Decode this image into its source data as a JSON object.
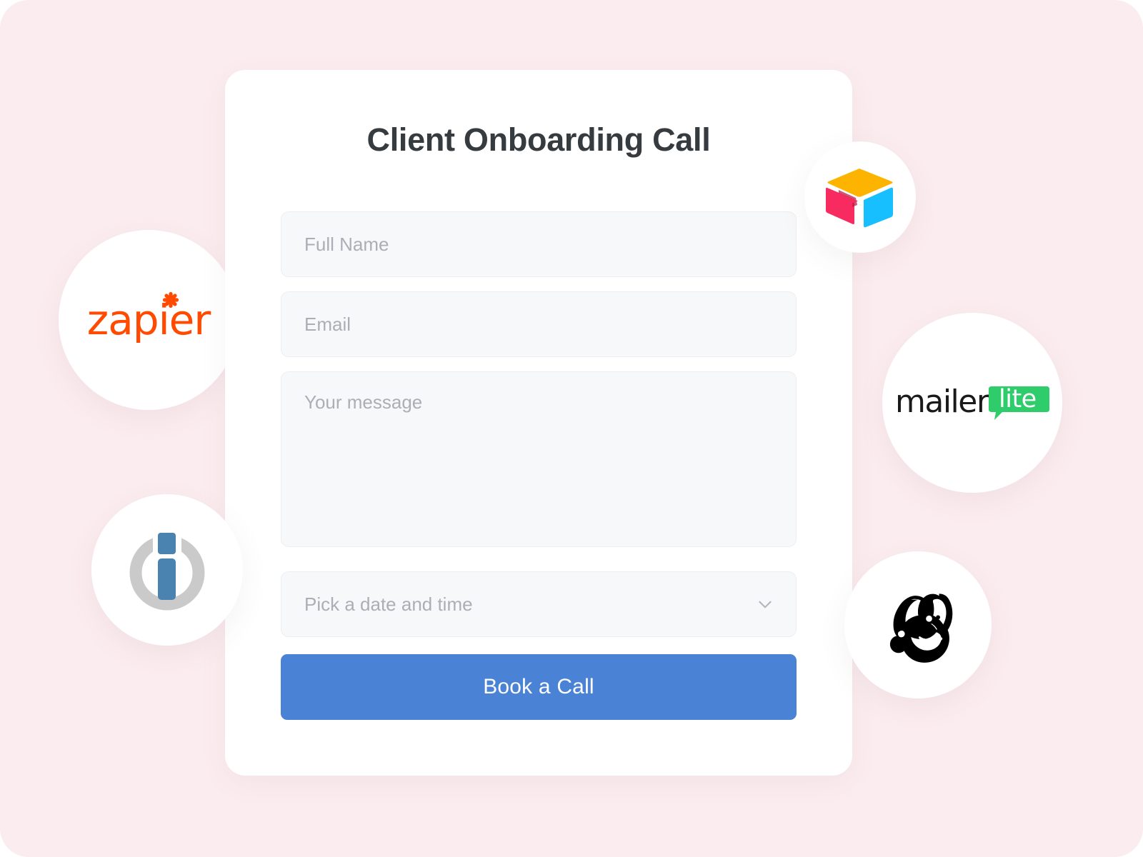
{
  "page": {
    "background_color": "#FBECEF",
    "card_background": "#FFFFFF"
  },
  "form": {
    "title": "Client Onboarding Call",
    "fields": [
      {
        "name": "full-name",
        "placeholder": "Full Name",
        "value": ""
      },
      {
        "name": "email",
        "placeholder": "Email",
        "value": ""
      },
      {
        "name": "message",
        "placeholder": "Your message",
        "value": ""
      },
      {
        "name": "date-time",
        "placeholder": "Pick a date and time",
        "value": ""
      }
    ],
    "submit_label": "Book a Call",
    "submit_color": "#4A82D6",
    "input_background": "#F7F8FA",
    "input_border": "#ECEEF1",
    "placeholder_color": "#AAAFB6",
    "title_color": "#363B3F",
    "dropdown_icon": "chevron-down-icon"
  },
  "badges": [
    {
      "name": "zapier",
      "label": "zapier",
      "icon": "zapier-logo",
      "color": "#FF4A00"
    },
    {
      "name": "activecampaign",
      "label": "ActiveCampaign",
      "icon": "activecampaign-logo",
      "ring_color": "#CACACA",
      "bar_color": "#4A82B0"
    },
    {
      "name": "airtable",
      "label": "Airtable",
      "icon": "airtable-logo",
      "colors": {
        "top": "#FCB400",
        "left": "#F82B60",
        "right": "#18BFFF",
        "left_shadow": "#BA1E48"
      }
    },
    {
      "name": "mailerlite",
      "label": "mailer",
      "badge_label": "lite",
      "icon": "mailerlite-logo",
      "badge_color": "#2ECC6B",
      "text_color": "#1A1A1A"
    },
    {
      "name": "mailchimp",
      "label": "Mailchimp",
      "icon": "mailchimp-logo",
      "color": "#000000"
    }
  ]
}
